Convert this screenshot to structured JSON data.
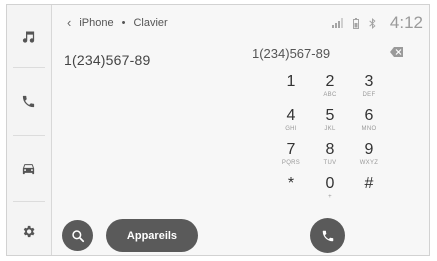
{
  "header": {
    "source": "iPhone",
    "separator": "•",
    "screen": "Clavier",
    "time": "4:12"
  },
  "contact": {
    "number": "1(234)567-89"
  },
  "dialer": {
    "display": "1(234)567-89",
    "keys": [
      {
        "digit": "1",
        "letters": ""
      },
      {
        "digit": "2",
        "letters": "ABC"
      },
      {
        "digit": "3",
        "letters": "DEF"
      },
      {
        "digit": "4",
        "letters": "GHI"
      },
      {
        "digit": "5",
        "letters": "JKL"
      },
      {
        "digit": "6",
        "letters": "MNO"
      },
      {
        "digit": "7",
        "letters": "PQRS"
      },
      {
        "digit": "8",
        "letters": "TUV"
      },
      {
        "digit": "9",
        "letters": "WXYZ"
      },
      {
        "digit": "*",
        "letters": ""
      },
      {
        "digit": "0",
        "letters": "+"
      },
      {
        "digit": "#",
        "letters": ""
      }
    ]
  },
  "bottom": {
    "devices_label": "Appareils"
  },
  "icons": {
    "sidebar": [
      "music-note-icon",
      "phone-icon",
      "car-icon",
      "gear-icon"
    ],
    "status": [
      "signal-icon",
      "battery-icon",
      "bluetooth-icon"
    ],
    "actions": [
      "search-icon",
      "backspace-icon",
      "phone-icon"
    ]
  },
  "colors": {
    "button": "#5a5a5a",
    "background": "#f7f7f7"
  }
}
